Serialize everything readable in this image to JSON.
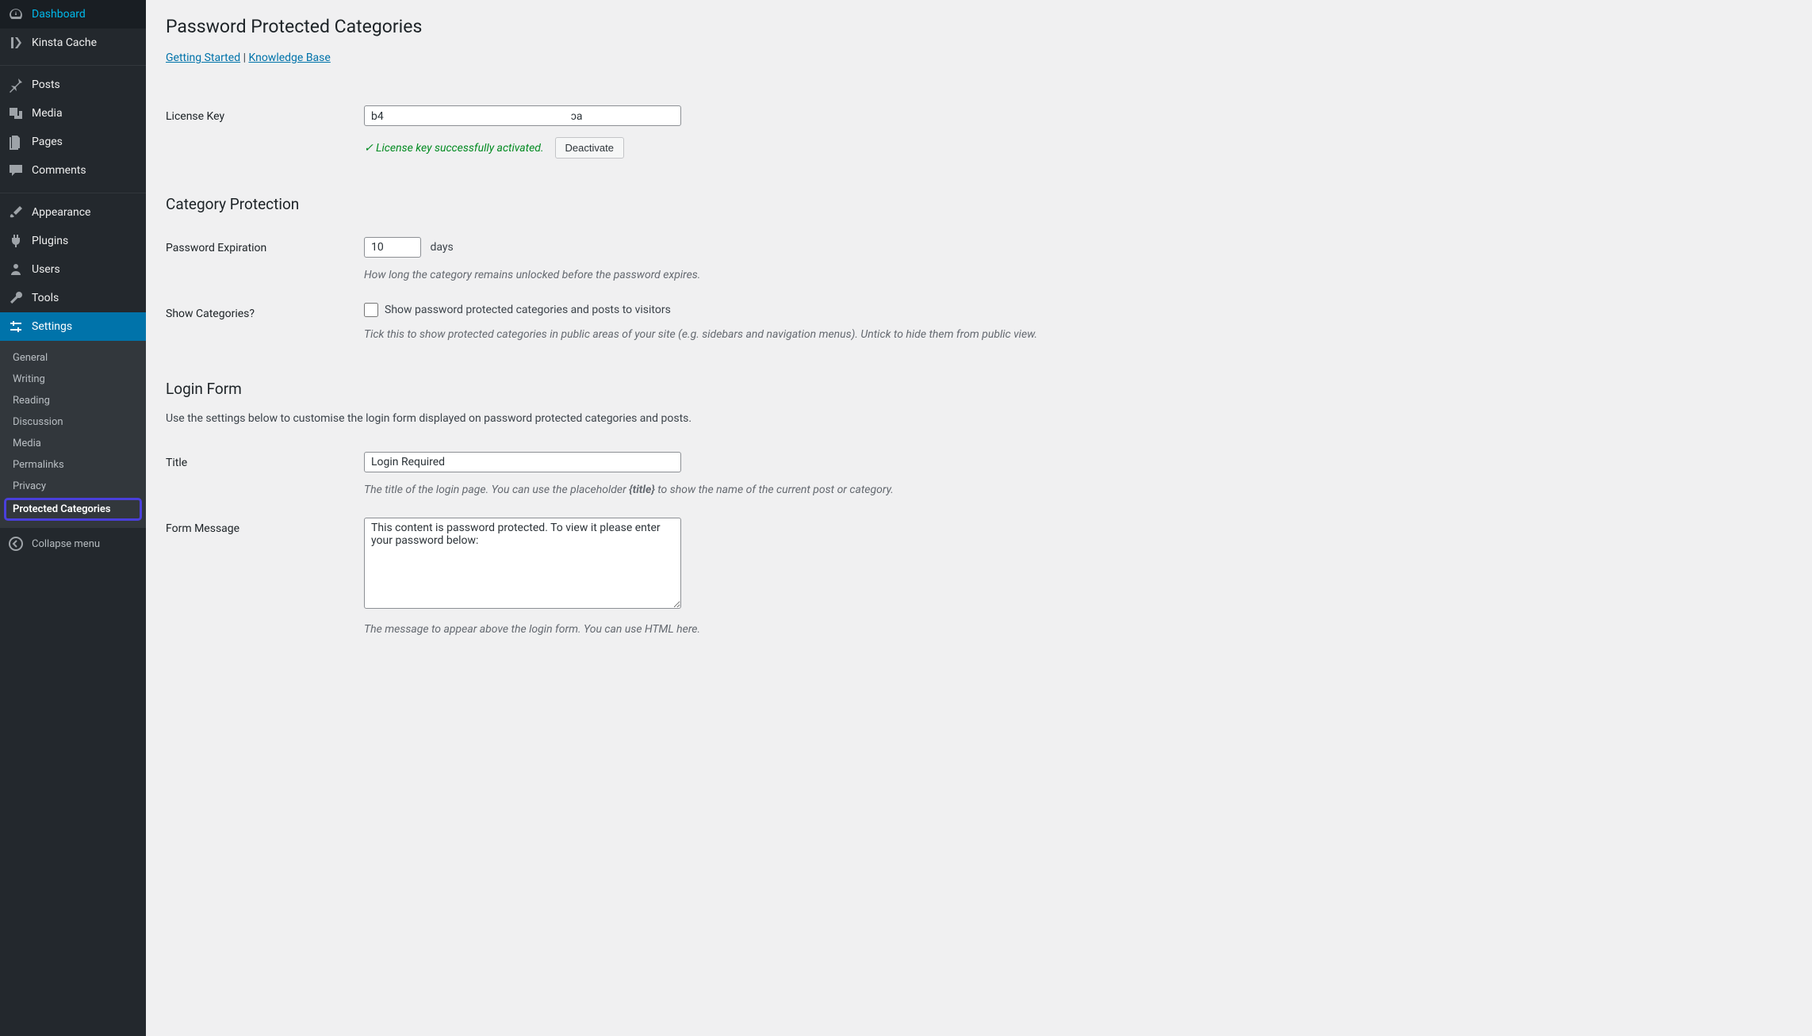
{
  "sidebar": {
    "items": [
      {
        "label": "Dashboard",
        "icon": "dashboard"
      },
      {
        "label": "Kinsta Cache",
        "icon": "kinsta"
      },
      {
        "label": "Posts",
        "icon": "pin"
      },
      {
        "label": "Media",
        "icon": "media"
      },
      {
        "label": "Pages",
        "icon": "pages"
      },
      {
        "label": "Comments",
        "icon": "comments"
      },
      {
        "label": "Appearance",
        "icon": "brush"
      },
      {
        "label": "Plugins",
        "icon": "plug"
      },
      {
        "label": "Users",
        "icon": "users"
      },
      {
        "label": "Tools",
        "icon": "wrench"
      },
      {
        "label": "Settings",
        "icon": "sliders",
        "active": true
      }
    ],
    "submenu": [
      {
        "label": "General"
      },
      {
        "label": "Writing"
      },
      {
        "label": "Reading"
      },
      {
        "label": "Discussion"
      },
      {
        "label": "Media"
      },
      {
        "label": "Permalinks"
      },
      {
        "label": "Privacy"
      },
      {
        "label": "Protected Categories",
        "current": true
      }
    ],
    "collapse": "Collapse menu"
  },
  "page": {
    "title": "Password Protected Categories",
    "links": {
      "getting_started": "Getting Started",
      "knowledge_base": "Knowledge Base"
    }
  },
  "license": {
    "label": "License Key",
    "value": "b4                                                                    ɔa",
    "status": "✓ License key successfully activated.",
    "deactivate": "Deactivate"
  },
  "category_protection": {
    "heading": "Category Protection",
    "expiration": {
      "label": "Password Expiration",
      "value": "10",
      "unit": "days",
      "help": "How long the category remains unlocked before the password expires."
    },
    "show_categories": {
      "label": "Show Categories?",
      "checkbox_label": "Show password protected categories and posts to visitors",
      "help": "Tick this to show protected categories in public areas of your site (e.g. sidebars and navigation menus). Untick to hide them from public view."
    }
  },
  "login_form": {
    "heading": "Login Form",
    "intro": "Use the settings below to customise the login form displayed on password protected categories and posts.",
    "title_field": {
      "label": "Title",
      "value": "Login Required",
      "help_before": "The title of the login page. You can use the placeholder ",
      "help_placeholder": "{title}",
      "help_after": " to show the name of the current post or category."
    },
    "message": {
      "label": "Form Message",
      "value": "This content is password protected. To view it please enter your password below:",
      "help": "The message to appear above the login form. You can use HTML here."
    }
  }
}
